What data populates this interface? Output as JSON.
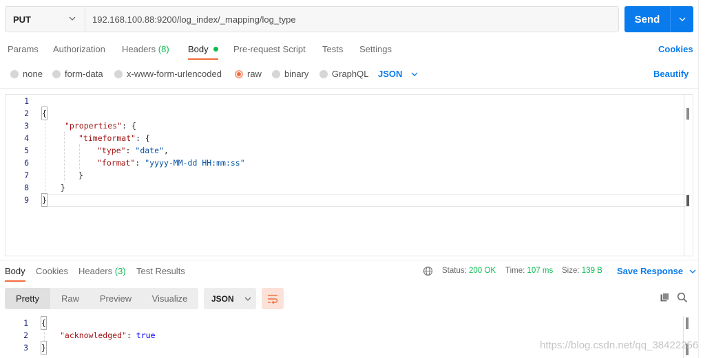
{
  "request": {
    "method": "PUT",
    "url": "192.168.100.88:9200/log_index/_mapping/log_type",
    "send_label": "Send"
  },
  "request_tabs": {
    "params": "Params",
    "authorization": "Authorization",
    "headers": "Headers",
    "headers_count": "(8)",
    "body": "Body",
    "prerequest": "Pre-request Script",
    "tests": "Tests",
    "settings": "Settings",
    "cookies": "Cookies"
  },
  "body_types": {
    "none": "none",
    "form_data": "form-data",
    "urlencoded": "x-www-form-urlencoded",
    "raw": "raw",
    "binary": "binary",
    "graphql": "GraphQL",
    "format": "JSON",
    "beautify": "Beautify",
    "selected": "raw"
  },
  "request_body": {
    "line_numbers": [
      "1",
      "2",
      "3",
      "4",
      "5",
      "6",
      "7",
      "8",
      "9"
    ],
    "l2": "{",
    "l3_key": "\"properties\"",
    "l3_rest": ": {",
    "l4_key": "\"timeformat\"",
    "l4_rest": ": {",
    "l5_key": "\"type\"",
    "l5_colon": ": ",
    "l5_val": "\"date\"",
    "l5_comma": ",",
    "l6_key": "\"format\"",
    "l6_colon": ": ",
    "l6_val": "\"yyyy-MM-dd HH:mm:ss\"",
    "l7": "}",
    "l8": "}",
    "l9": "}"
  },
  "response_tabs": {
    "body": "Body",
    "cookies": "Cookies",
    "headers": "Headers",
    "headers_count": "(3)",
    "test_results": "Test Results"
  },
  "response_meta": {
    "status_label": "Status:",
    "status_value": "200 OK",
    "time_label": "Time:",
    "time_value": "107 ms",
    "size_label": "Size:",
    "size_value": "139 B",
    "save_response": "Save Response"
  },
  "response_view": {
    "pretty": "Pretty",
    "raw": "Raw",
    "preview": "Preview",
    "visualize": "Visualize",
    "format": "JSON"
  },
  "response_body": {
    "line_numbers": [
      "1",
      "2",
      "3"
    ],
    "l1": "{",
    "l2_key": "\"acknowledged\"",
    "l2_colon": ": ",
    "l2_val": "true",
    "l3": "}"
  },
  "watermark": "https://blog.csdn.net/qq_38422256",
  "colors": {
    "accent": "#097bed",
    "active_tab": "#f26b3a",
    "success": "#0cbb52"
  }
}
